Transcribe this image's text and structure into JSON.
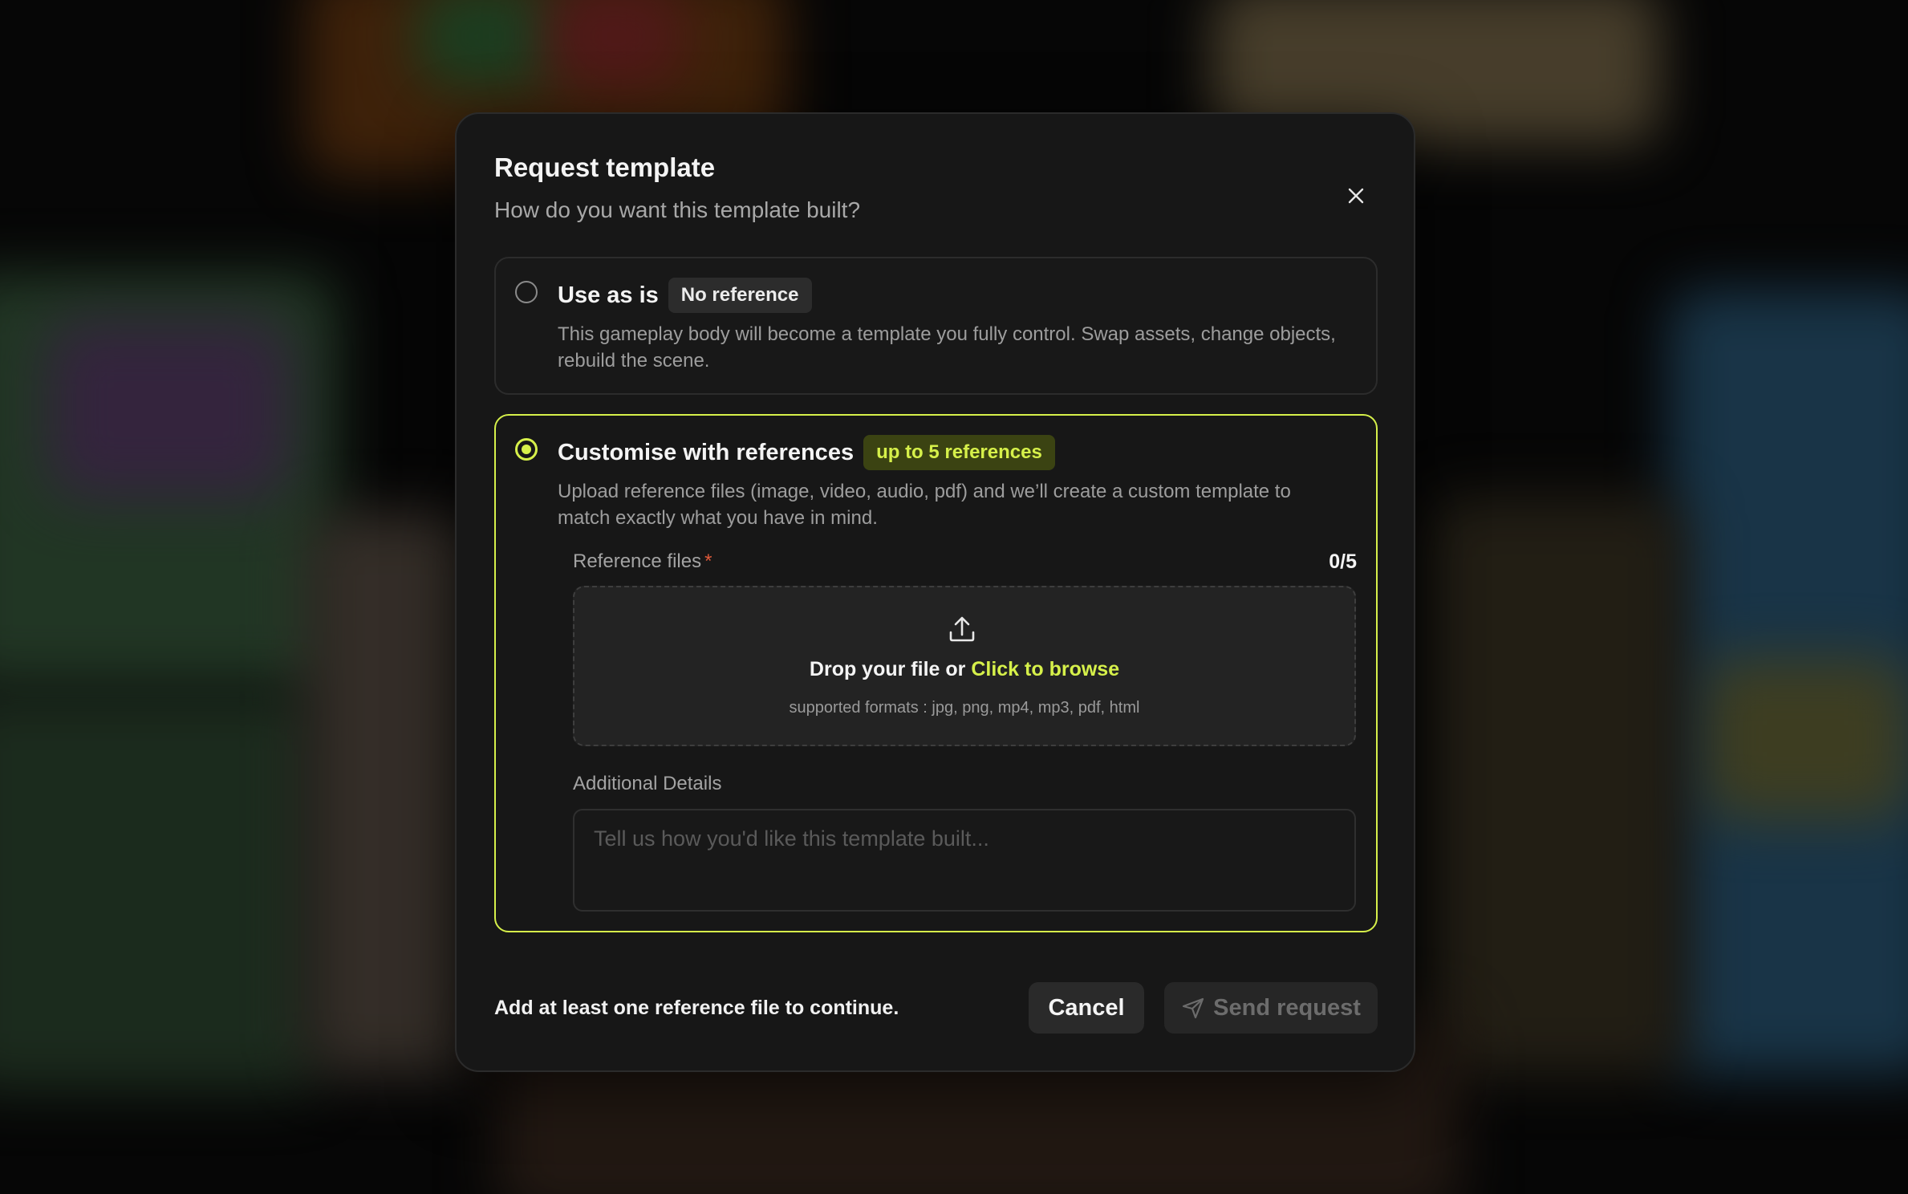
{
  "colors": {
    "accent": "#d6f04a",
    "modal_bg": "#171717",
    "badge_accent_bg": "#3b4312",
    "required": "#e05a3a"
  },
  "modal": {
    "title": "Request template",
    "subtitle": "How do you want this template built?",
    "close_icon": "close-icon"
  },
  "options": [
    {
      "title": "Use as is",
      "badge": "No reference",
      "description": "This gameplay body will become a template you fully control. Swap assets, change objects, rebuild the scene.",
      "selected": false
    },
    {
      "title": "Customise with references",
      "badge": "up to 5 references",
      "description": "Upload reference files (image, video, audio, pdf) and we’ll create a custom template to match exactly what you have in mind.",
      "selected": true
    }
  ],
  "reference_files": {
    "label": "Reference files",
    "required_mark": "*",
    "count": "0/5",
    "upload_icon": "upload-icon",
    "drop_text": "Drop your file or",
    "browse_text": "Click to browse",
    "formats": "supported formats : jpg, png, mp4, mp3, pdf, html"
  },
  "additional_details": {
    "label": "Additional Details",
    "placeholder": "Tell us how you'd like this template built...",
    "value": ""
  },
  "footer": {
    "hint": "Add at least one reference file to continue.",
    "cancel_label": "Cancel",
    "send_label": "Send request",
    "send_icon": "send-icon",
    "send_disabled": true
  }
}
